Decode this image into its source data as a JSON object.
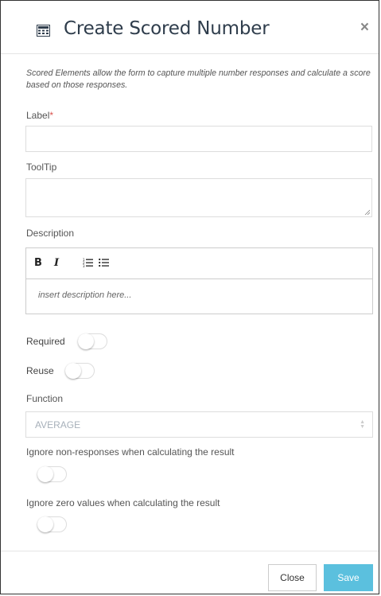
{
  "dialog": {
    "title": "Create Scored Number",
    "title_icon": "calculator-icon",
    "close_glyph": "×",
    "intro": "Scored Elements allow the form to capture multiple number responses and calculate a score based on those responses."
  },
  "fields": {
    "label": {
      "text": "Label",
      "required_marker": "*",
      "value": ""
    },
    "tooltip": {
      "text": "ToolTip",
      "value": ""
    },
    "description": {
      "text": "Description",
      "toolbar": {
        "bold": "B",
        "italic": "I"
      },
      "placeholder": "insert description here..."
    },
    "required": {
      "text": "Required",
      "on": false
    },
    "reuse": {
      "text": "Reuse",
      "on": false
    },
    "function": {
      "text": "Function",
      "selected": "AVERAGE"
    },
    "ignore_non_responses": {
      "text": "Ignore non-responses when calculating the result",
      "on": false
    },
    "ignore_zero": {
      "text": "Ignore zero values when calculating the result",
      "on": false
    }
  },
  "footer": {
    "close_label": "Close",
    "save_label": "Save"
  },
  "colors": {
    "save_button": "#5bc0de",
    "required_star": "#d9534f",
    "title": "#2f3d4c"
  }
}
